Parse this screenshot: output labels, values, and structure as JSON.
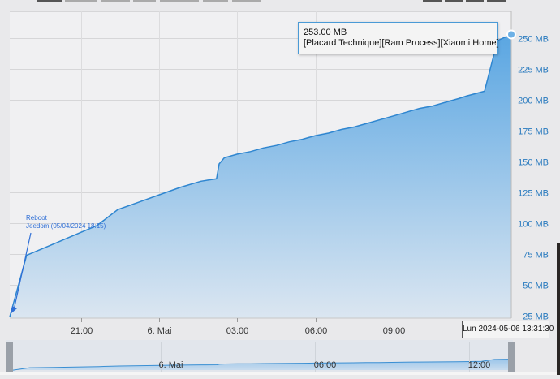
{
  "chart_data": {
    "type": "area",
    "y_ticks": [
      "25 MB",
      "50 MB",
      "75 MB",
      "100 MB",
      "125 MB",
      "150 MB",
      "175 MB",
      "200 MB",
      "225 MB",
      "250 MB"
    ],
    "y_tick_values": [
      25,
      50,
      75,
      100,
      125,
      150,
      175,
      200,
      225,
      250
    ],
    "ylim": [
      25,
      250
    ],
    "x_ticks": [
      "21:00",
      "6. Mai",
      "03:00",
      "06:00",
      "09:00"
    ],
    "x_tick_hours": [
      21,
      24,
      27,
      30,
      33
    ],
    "xlim_hours": [
      18.25,
      37.53
    ],
    "grid": true,
    "series": [
      {
        "x_hours": [
          18.25,
          18.9,
          19.8,
          20.7,
          21.6,
          22.4,
          23.2,
          24.0,
          24.8,
          25.6,
          26.2,
          26.3,
          26.5,
          27.0,
          27.5,
          28.0,
          28.5,
          29.0,
          29.5,
          30.0,
          30.5,
          31.0,
          31.5,
          32.0,
          32.5,
          33.0,
          33.5,
          34.0,
          34.5,
          35.0,
          35.5,
          35.8,
          36.5,
          37.0,
          37.53
        ],
        "values": [
          24,
          74,
          82,
          90,
          98,
          111,
          117,
          123,
          129,
          134,
          136,
          148,
          153,
          156,
          158,
          161,
          163,
          166,
          168,
          171,
          173,
          176,
          178,
          181,
          184,
          187,
          190,
          193,
          195,
          198,
          201,
          203,
          207,
          248,
          253
        ]
      }
    ],
    "annotation": {
      "label_line1": "Reboot",
      "label_line2": "Jeedom (05/04/2024 18:15)"
    },
    "tooltip": {
      "value": "253.00 MB",
      "series_name": "[Placard Technique][Ram Process][Xiaomi Home]"
    },
    "crosshair_label": "Lun 2024-05-06 13:31:30",
    "navigator_ticks": [
      "6. Mai",
      "06:00",
      "12:00"
    ],
    "colors": {
      "area_top": "#5aa6e2",
      "area_bottom": "#dbe6f1",
      "line": "#2f86d0",
      "axis_text": "#2a7bbf",
      "annotation": "#2f6fd6"
    }
  }
}
